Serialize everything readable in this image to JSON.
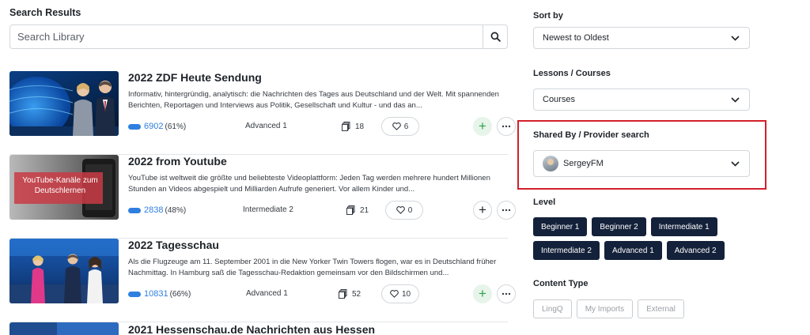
{
  "search": {
    "section_title": "Search Results",
    "placeholder": "Search Library"
  },
  "results": [
    {
      "title": "2022 ZDF Heute Sendung",
      "description": "Informativ, hintergründig, analytisch: die Nachrichten des Tages aus Deutschland und der Welt. Mit spannenden Berichten, Reportagen und Interviews aus Politik, Gesellschaft und Kultur - und das an...",
      "known_words": "6902",
      "known_pct": "(61%)",
      "level": "Advanced 1",
      "lessons": "18",
      "likes": "6",
      "added": true
    },
    {
      "title": "2022 from Youtube",
      "description": "YouTube ist weltweit die größte und beliebteste Videoplattform: Jeden Tag werden mehrere hundert Millionen Stunden an Videos abgespielt und Milliarden Aufrufe generiert. Vor allem Kinder und...",
      "known_words": "2838",
      "known_pct": "(48%)",
      "level": "Intermediate 2",
      "lessons": "21",
      "likes": "0",
      "added": false,
      "thumb_text": "YouTube-Kanäle zum Deutschlernen"
    },
    {
      "title": "2022 Tagesschau",
      "description": "Als die Flugzeuge am 11. September 2001 in die New Yorker Twin Towers flogen, war es in Deutschland früher Nachmittag. In Hamburg saß die Tagesschau-Redaktion gemeinsam vor den Bildschirmen und...",
      "known_words": "10831",
      "known_pct": "(66%)",
      "level": "Advanced 1",
      "lessons": "52",
      "likes": "10",
      "added": true
    },
    {
      "title": "2021 Hessenschau.de Nachrichten aus Hessen"
    }
  ],
  "filters": {
    "sort_label": "Sort by",
    "sort_value": "Newest to Oldest",
    "type_label": "Lessons / Courses",
    "type_value": "Courses",
    "shared_label": "Shared By / Provider search",
    "shared_value": "SergeyFM",
    "level_label": "Level",
    "levels": [
      "Beginner 1",
      "Beginner 2",
      "Intermediate 1",
      "Intermediate 2",
      "Advanced 1",
      "Advanced 2"
    ],
    "content_label": "Content Type",
    "content_types": [
      "LingQ",
      "My Imports",
      "External"
    ]
  },
  "colors": {
    "accent_blue": "#2f7fe0",
    "chip_dark": "#14213a",
    "highlight_red": "#d3202b",
    "add_green": "#2da24a"
  }
}
